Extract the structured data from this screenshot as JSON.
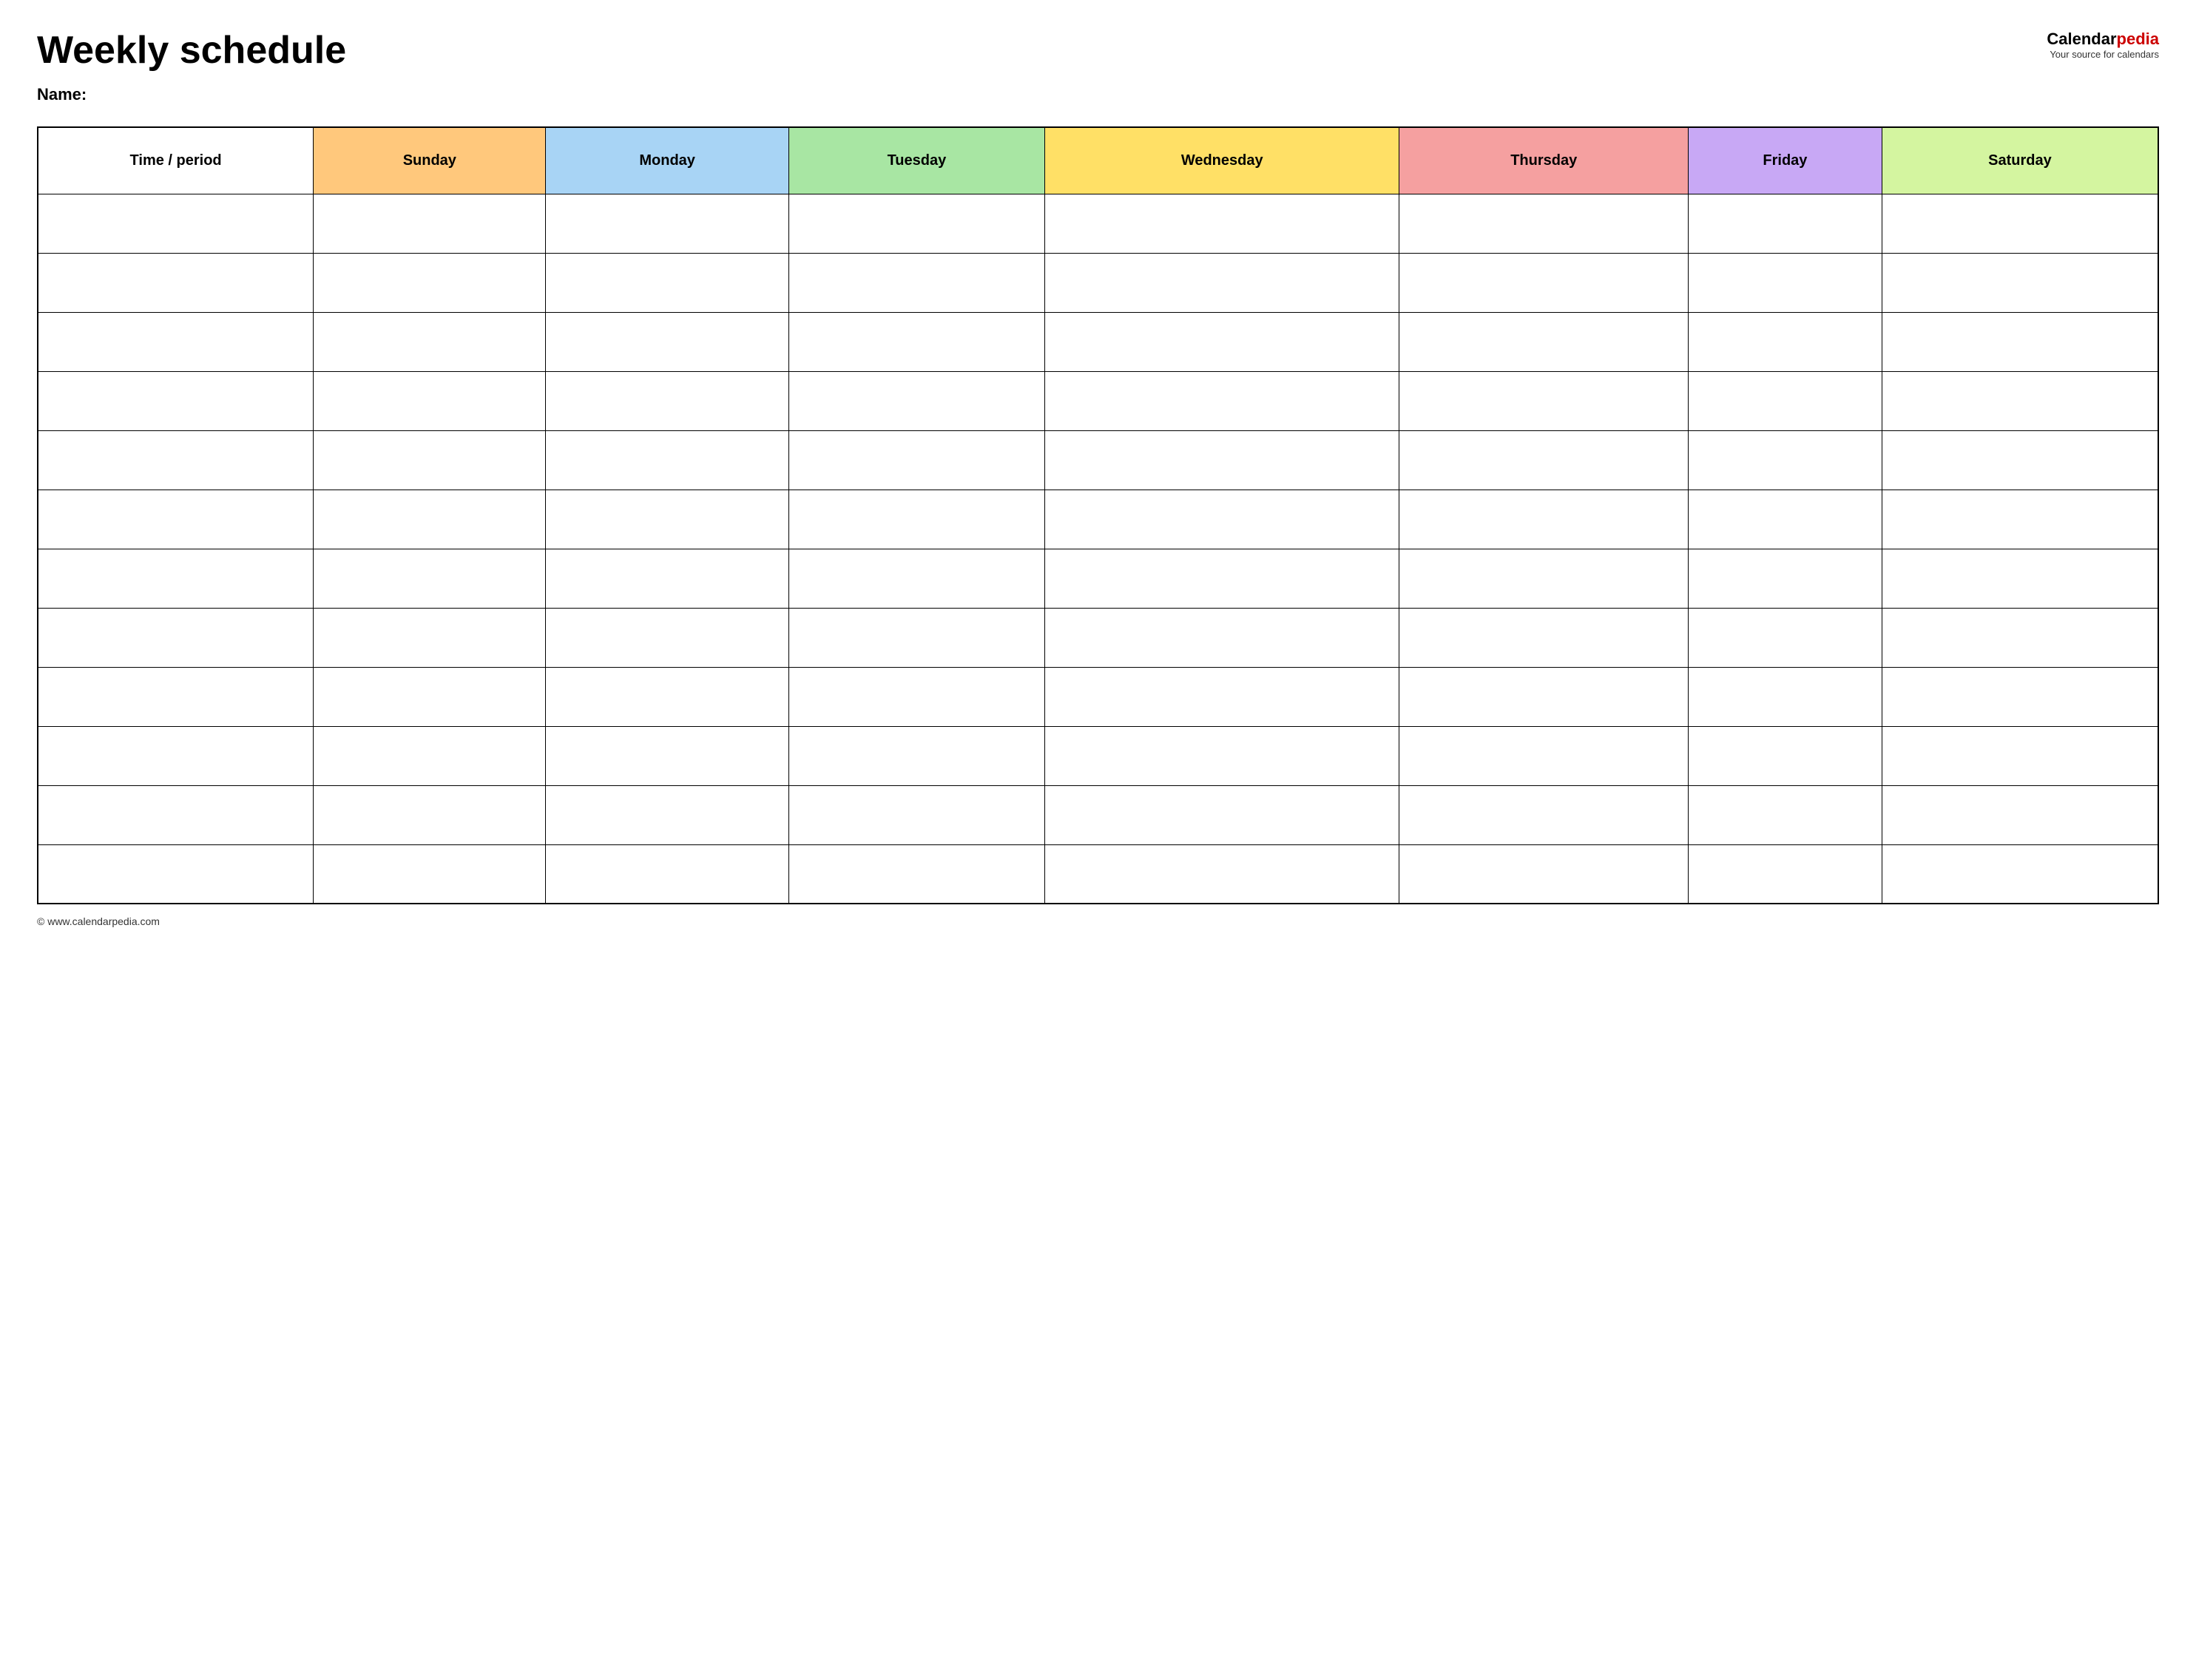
{
  "header": {
    "title": "Weekly schedule",
    "name_label": "Name:",
    "logo": {
      "part1": "Calendar",
      "part2": "pedia",
      "subtitle": "Your source for calendars"
    }
  },
  "table": {
    "columns": [
      {
        "id": "time",
        "label": "Time / period",
        "class": "col-time"
      },
      {
        "id": "sunday",
        "label": "Sunday",
        "class": "col-sunday"
      },
      {
        "id": "monday",
        "label": "Monday",
        "class": "col-monday"
      },
      {
        "id": "tuesday",
        "label": "Tuesday",
        "class": "col-tuesday"
      },
      {
        "id": "wednesday",
        "label": "Wednesday",
        "class": "col-wednesday"
      },
      {
        "id": "thursday",
        "label": "Thursday",
        "class": "col-thursday"
      },
      {
        "id": "friday",
        "label": "Friday",
        "class": "col-friday"
      },
      {
        "id": "saturday",
        "label": "Saturday",
        "class": "col-saturday"
      }
    ],
    "row_count": 12
  },
  "footer": {
    "url": "© www.calendarpedia.com"
  }
}
